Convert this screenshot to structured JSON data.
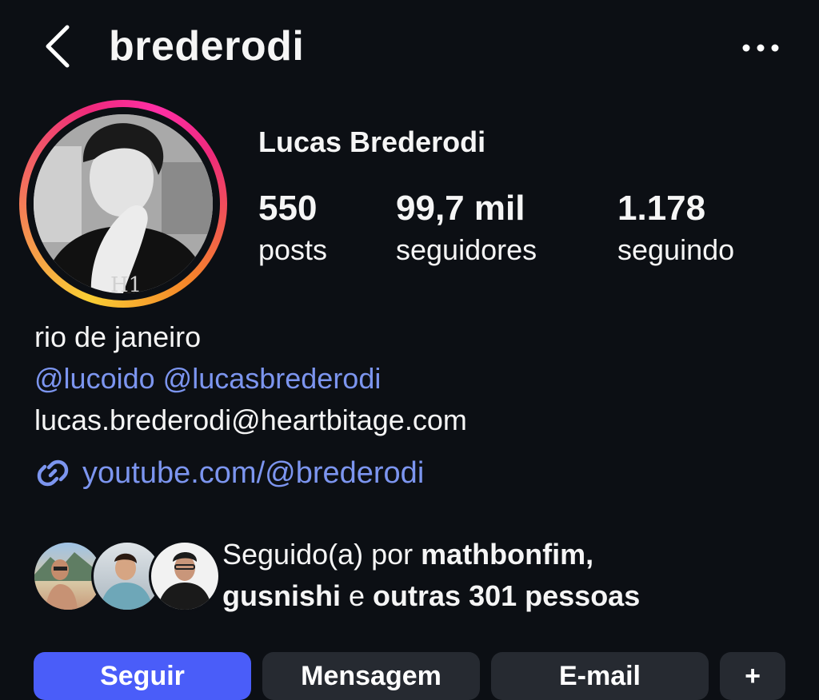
{
  "header": {
    "username": "brederodi"
  },
  "profile": {
    "name": "Lucas Brederodi",
    "stats": [
      {
        "number": "550",
        "label": "posts"
      },
      {
        "number": "99,7 mil",
        "label": "seguidores"
      },
      {
        "number": "1.178",
        "label": "seguindo"
      }
    ]
  },
  "bio": {
    "location": "rio de janeiro",
    "mention_1": "@lucoido",
    "mention_2": "@lucasbrederodi",
    "email": "lucas.brederodi@heartbitage.com",
    "link": "youtube.com/@brederodi"
  },
  "followed_by": {
    "prefix": "Seguido(a) por ",
    "user_1": "mathbonfim",
    "sep_1": ",",
    "user_2": "gusnishi",
    "conj": " e ",
    "others": "outras 301 pessoas"
  },
  "actions": {
    "follow_label": "Seguir",
    "message_label": "Mensagem",
    "email_label": "E-mail",
    "more_label": "+"
  },
  "colors": {
    "background": "#0c0f14",
    "link": "#7c95ef",
    "primary_button": "#4a5df9",
    "secondary_button": "#262a31"
  }
}
